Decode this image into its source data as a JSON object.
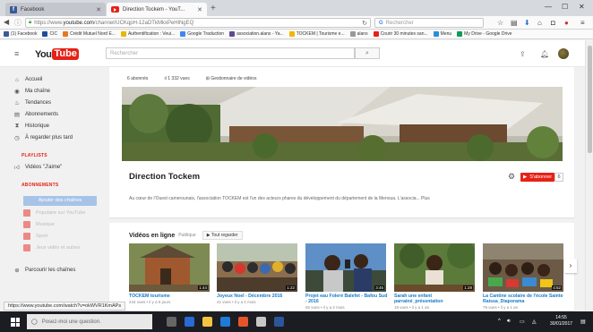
{
  "browser": {
    "tabs": [
      {
        "title": "Facebook",
        "active": false
      },
      {
        "title": "Direction Tockem - YouT...",
        "active": true
      }
    ],
    "url_prefix": "https://www.",
    "url_domain": "youtube.com",
    "url_path": "/channel/UCKqpH-12aDTkMkxPeHlNgEQ",
    "search_placeholder": "Rechercher",
    "bookmarks": [
      {
        "label": "(1) Facebook",
        "color": "#3b5998"
      },
      {
        "label": "CIC",
        "color": "#1a4f9c"
      },
      {
        "label": "Crédit Mutuel Nord E...",
        "color": "#e87722"
      },
      {
        "label": "Authentification : Veui...",
        "color": "#e6b800"
      },
      {
        "label": "Google Traduction",
        "color": "#4285f4"
      },
      {
        "label": "association.alans - Ya...",
        "color": "#5f4b8b"
      },
      {
        "label": "TOCKEM | Tourisme e...",
        "color": "#f4b400"
      },
      {
        "label": "alans",
        "color": "#999999"
      },
      {
        "label": "Courir 30 minutes san...",
        "color": "#e62117"
      },
      {
        "label": "Menu",
        "color": "#2a8fd8"
      },
      {
        "label": "My Drive - Google Drive",
        "color": "#0f9d58"
      }
    ],
    "status_url": "https://www.youtube.com/watch?v=okWVR1KmAPs"
  },
  "youtube": {
    "logo_you": "You",
    "logo_tube": "Tube",
    "search_placeholder": "Rechercher"
  },
  "sidebar": {
    "items": [
      {
        "label": "Accueil",
        "icon": "⌂"
      },
      {
        "label": "Ma chaîne",
        "icon": "◉"
      },
      {
        "label": "Tendances",
        "icon": "♨"
      },
      {
        "label": "Abonnements",
        "icon": "▤"
      },
      {
        "label": "Historique",
        "icon": "⧗"
      },
      {
        "label": "À regarder plus tard",
        "icon": "◷"
      }
    ],
    "playlists_title": "PLAYLISTS",
    "playlist_item": "Vidéos \"J'aime\"",
    "subscriptions_title": "ABONNEMENTS",
    "add_channels_button": "Ajouter des chaînes",
    "subscriptions": [
      {
        "label": "Populaire sur YouTube"
      },
      {
        "label": "Musique"
      },
      {
        "label": "Sport"
      },
      {
        "label": "Jeux vidéo et autres"
      }
    ],
    "browse_channels": "Parcourir les chaînes"
  },
  "channel": {
    "subscribers_stat": "6 abonnés",
    "views_stat": "1 332 vues",
    "manager_link": "Gestionnaire de vidéos",
    "name": "Direction Tockem",
    "subscribe_label": "S'abonner",
    "subscriber_count": "6",
    "description": "Au cœur de l'Ouest camerounais, l'association TOCKEM est l'un des acteurs phares du développement du département de la Menoua. L'associa... Plus"
  },
  "uploads": {
    "title": "Vidéos en ligne",
    "visibility": "Publique",
    "play_all": "Tout regarder",
    "videos": [
      {
        "title": "TOCKEM tourisme",
        "meta": "244 vues • il y a 6 jours",
        "duration": "1:44"
      },
      {
        "title": "Joyeux Noel - Décembre 2016",
        "meta": "41 vues • il y a 1 mois",
        "duration": "1:22"
      },
      {
        "title": "Projet eau Foleré Balefet - Bafou Sud - 2016",
        "meta": "92 vues • il y a 2 mois",
        "duration": "3:45"
      },
      {
        "title": "Sarah une enfant parrainé_présentation",
        "meta": "19 vues • il y a 1 an",
        "duration": "1:28"
      },
      {
        "title": "La Cantine scolaire de l'école Sainte Raissa_Diaporama",
        "meta": "79 vues • il y a 1 an",
        "duration": "4:52"
      }
    ]
  },
  "taskbar": {
    "search_placeholder": "Posez-moi une question.",
    "time": "14:55",
    "date": "30/01/2017"
  }
}
